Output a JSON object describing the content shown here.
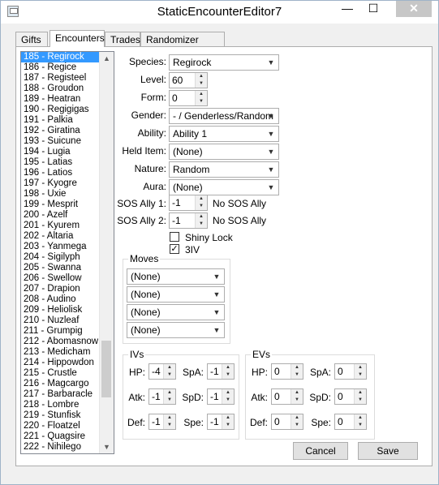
{
  "window": {
    "title": "StaticEncounterEditor7",
    "close_label": "✕",
    "min_label": "—",
    "max_label": "☐"
  },
  "tabs": [
    "Gifts",
    "Encounters",
    "Trades",
    "Randomizer Options"
  ],
  "encounters": [
    "185 - Regirock",
    "186 - Regice",
    "187 - Registeel",
    "188 - Groudon",
    "189 - Heatran",
    "190 - Regigigas",
    "191 - Palkia",
    "192 - Giratina",
    "193 - Suicune",
    "194 - Lugia",
    "195 - Latias",
    "196 - Latios",
    "197 - Kyogre",
    "198 - Uxie",
    "199 - Mesprit",
    "200 - Azelf",
    "201 - Kyurem",
    "202 - Altaria",
    "203 - Yanmega",
    "204 - Sigilyph",
    "205 - Swanna",
    "206 - Swellow",
    "207 - Drapion",
    "208 - Audino",
    "209 - Heliolisk",
    "210 - Nuzleaf",
    "211 - Grumpig",
    "212 - Abomasnow",
    "213 - Medicham",
    "214 - Hippowdon",
    "215 - Crustle",
    "216 - Magcargo",
    "217 - Barbaracle",
    "218 - Lombre",
    "219 - Stunfisk",
    "220 - Floatzel",
    "221 - Quagsire",
    "222 - Nihilego"
  ],
  "selected_index": 0,
  "fields": {
    "species": {
      "label": "Species:",
      "value": "Regirock"
    },
    "level": {
      "label": "Level:",
      "value": "60"
    },
    "form": {
      "label": "Form:",
      "value": "0"
    },
    "gender": {
      "label": "Gender:",
      "value": "- / Genderless/Random"
    },
    "ability": {
      "label": "Ability:",
      "value": "Ability 1"
    },
    "held_item": {
      "label": "Held Item:",
      "value": "(None)"
    },
    "nature": {
      "label": "Nature:",
      "value": "Random"
    },
    "aura": {
      "label": "Aura:",
      "value": "(None)"
    },
    "sos1": {
      "label": "SOS Ally 1:",
      "value": "-1",
      "note": "No SOS Ally"
    },
    "sos2": {
      "label": "SOS Ally 2:",
      "value": "-1",
      "note": "No SOS Ally"
    },
    "shiny_lock": {
      "label": "Shiny Lock",
      "checked": false
    },
    "three_iv": {
      "label": "3IV",
      "checked": true,
      "mark": "✓"
    }
  },
  "moves": {
    "title": "Moves",
    "values": [
      "(None)",
      "(None)",
      "(None)",
      "(None)"
    ]
  },
  "ivs": {
    "title": "IVs",
    "hp": {
      "label": "HP:",
      "value": "-4"
    },
    "atk": {
      "label": "Atk:",
      "value": "-1"
    },
    "def": {
      "label": "Def:",
      "value": "-1"
    },
    "spa": {
      "label": "SpA:",
      "value": "-1"
    },
    "spd": {
      "label": "SpD:",
      "value": "-1"
    },
    "spe": {
      "label": "Spe:",
      "value": "-1"
    }
  },
  "evs": {
    "title": "EVs",
    "hp": {
      "label": "HP:",
      "value": "0"
    },
    "atk": {
      "label": "Atk:",
      "value": "0"
    },
    "def": {
      "label": "Def:",
      "value": "0"
    },
    "spa": {
      "label": "SpA:",
      "value": "0"
    },
    "spd": {
      "label": "SpD:",
      "value": "0"
    },
    "spe": {
      "label": "Spe:",
      "value": "0"
    }
  },
  "buttons": {
    "cancel": "Cancel",
    "save": "Save"
  },
  "icons": {
    "dropdown": "chevron-down-icon",
    "spin_up": "spin-up-icon",
    "spin_down": "spin-down-icon"
  }
}
